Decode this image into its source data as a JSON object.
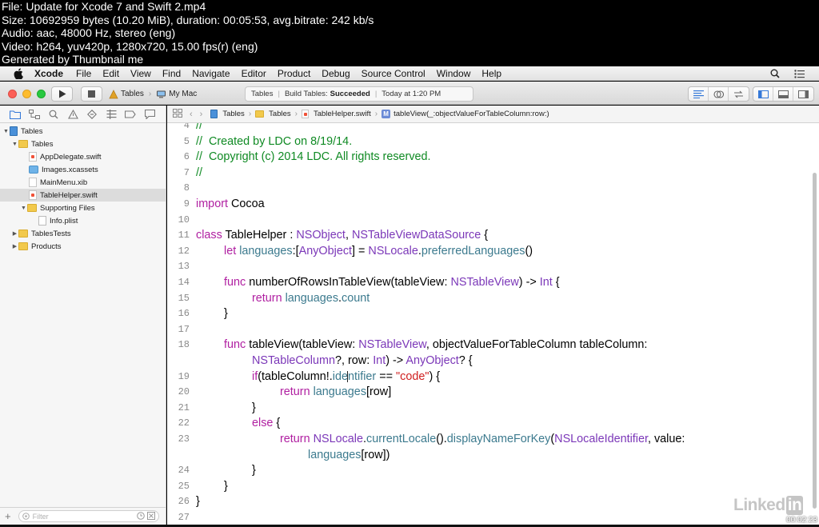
{
  "thumbnail_info": {
    "file": "File: Update for Xcode 7 and Swift 2.mp4",
    "size": "Size: 10692959 bytes (10.20 MiB), duration: 00:05:53, avg.bitrate: 242 kb/s",
    "audio": "Audio: aac, 48000 Hz, stereo (eng)",
    "video": "Video: h264, yuv420p, 1280x720, 15.00 fps(r) (eng)",
    "generator": "Generated by Thumbnail me"
  },
  "menubar": {
    "app": "Xcode",
    "items": [
      "File",
      "Edit",
      "View",
      "Find",
      "Navigate",
      "Editor",
      "Product",
      "Debug",
      "Source Control",
      "Window",
      "Help"
    ]
  },
  "toolbar": {
    "scheme": "Tables",
    "destination": "My Mac",
    "activity": {
      "project": "Tables",
      "build_prefix": "Build Tables:",
      "build_status": "Succeeded",
      "time": "Today at 1:20 PM"
    }
  },
  "navigator": {
    "items": [
      {
        "label": "Tables"
      },
      {
        "label": "Tables"
      },
      {
        "label": "AppDelegate.swift"
      },
      {
        "label": "Images.xcassets"
      },
      {
        "label": "MainMenu.xib"
      },
      {
        "label": "TableHelper.swift"
      },
      {
        "label": "Supporting Files"
      },
      {
        "label": "Info.plist"
      },
      {
        "label": "TablesTests"
      },
      {
        "label": "Products"
      }
    ],
    "filter_placeholder": "Filter"
  },
  "jumpbar": {
    "crumbs": [
      "Tables",
      "Tables",
      "TableHelper.swift",
      "tableView(_:objectValueForTableColumn:row:)"
    ]
  },
  "editor": {
    "lines": [
      {
        "num": "4",
        "text": "//"
      },
      {
        "num": "5",
        "text": "//  Created by LDC on 8/19/14."
      },
      {
        "num": "6",
        "text": "//  Copyright (c) 2014 LDC. All rights reserved."
      },
      {
        "num": "7",
        "text": "//"
      },
      {
        "num": "8",
        "text": ""
      },
      {
        "num": "9",
        "text": "import Cocoa"
      },
      {
        "num": "10",
        "text": ""
      },
      {
        "num": "11",
        "text": "class TableHelper : NSObject, NSTableViewDataSource {"
      },
      {
        "num": "12",
        "text": "let languages:[AnyObject] = NSLocale.preferredLanguages()"
      },
      {
        "num": "13",
        "text": ""
      },
      {
        "num": "14",
        "text": "func numberOfRowsInTableView(tableView: NSTableView) -> Int {"
      },
      {
        "num": "15",
        "text": "return languages.count"
      },
      {
        "num": "16",
        "text": "}"
      },
      {
        "num": "17",
        "text": ""
      },
      {
        "num": "18",
        "text": "func tableView(tableView: NSTableView, objectValueForTableColumn tableColumn:"
      },
      {
        "num": "",
        "text": "NSTableColumn?, row: Int) -> AnyObject? {"
      },
      {
        "num": "19",
        "text": "if(tableColumn!.identifier == \"code\") {"
      },
      {
        "num": "20",
        "text": "return languages[row]"
      },
      {
        "num": "21",
        "text": "}"
      },
      {
        "num": "22",
        "text": "else {"
      },
      {
        "num": "23",
        "text": "return NSLocale.currentLocale().displayNameForKey(NSLocaleIdentifier, value:"
      },
      {
        "num": "",
        "text": "languages[row])"
      },
      {
        "num": "24",
        "text": "}"
      },
      {
        "num": "25",
        "text": "}"
      },
      {
        "num": "26",
        "text": "}"
      },
      {
        "num": "27",
        "text": ""
      }
    ]
  },
  "watermark": "Linkedin",
  "timestamp": "00:02:23",
  "colors": {
    "keyword": "#b01fa1",
    "type": "#7b37b8",
    "comment": "#0f8a23",
    "string": "#cf1f1f",
    "property": "#3c7a8e"
  }
}
